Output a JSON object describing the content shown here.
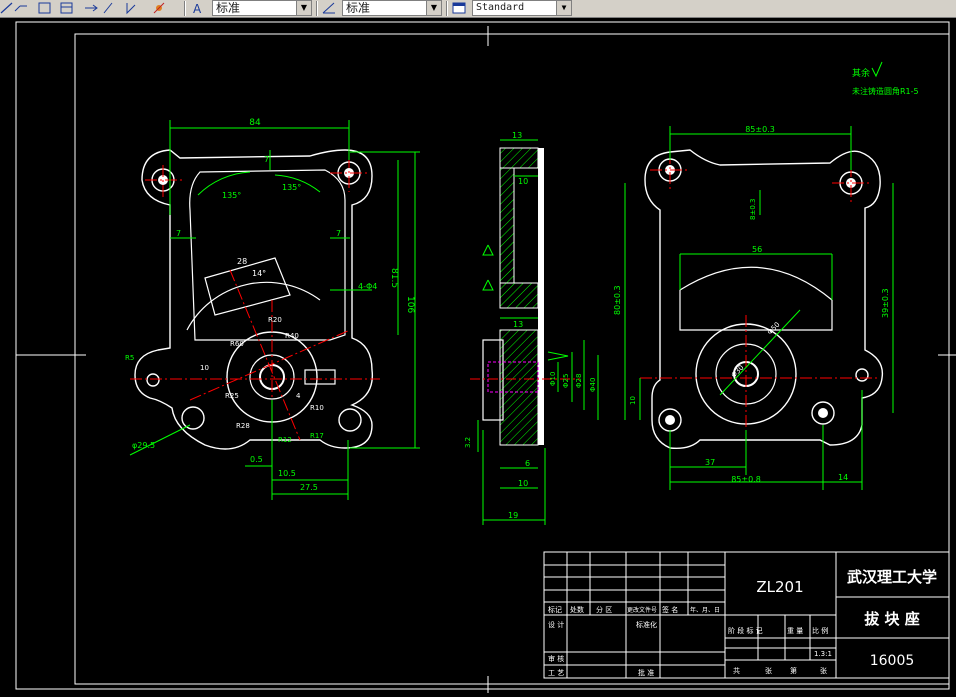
{
  "toolbar": {
    "text_style_value": "标准",
    "dim_style_value": "标准",
    "table_style_value": "Standard"
  },
  "drawing": {
    "roughness_symbol": "其余",
    "tech_note": "未注铸造圆角R1-5",
    "front_view_dims": {
      "width_top": "84",
      "angle_left": "135°",
      "angle_right": "135°",
      "d7_top": "7",
      "d7_left": "7",
      "d7_right": "7",
      "height_81_5": "81.5",
      "height_106": "106",
      "holes": "4-Φ4",
      "d28": "28",
      "angle_14": "14°",
      "r_lab_1": "R20",
      "r_lab_2": "R60",
      "r_lab_3": "R40",
      "r_lab_4": "R25",
      "r_lab_5": "R28",
      "d_0_5": "0.5",
      "d_10_5": "10.5",
      "d_27_5": "27.5",
      "d_r12": "R12",
      "d_phi_29_5": "φ29.5",
      "d_r5": "R5",
      "d_10_left": "10",
      "d_4": "4",
      "d_r10": "R10",
      "d_r17": "R17"
    },
    "section_view_dims": {
      "d13_top": "13",
      "d10_top": "10",
      "d13_mid": "13",
      "d_phi10": "Φ10",
      "d_phi25": "Φ25",
      "d_phi28": "Φ28",
      "d_phi40": "Φ40",
      "d6": "6",
      "d10_bot": "10",
      "d19": "19",
      "d3_2": "3.2"
    },
    "rear_view_dims": {
      "d85_top": "85±0.3",
      "d8_3": "8±0.3",
      "d56": "56",
      "d80_3": "80±0.3",
      "d39_3": "39±0.3",
      "d_phi50": "Φ50",
      "d_phi30": "Φ30",
      "d10": "10",
      "d37": "37",
      "d85_bot": "85±0.8",
      "d14": "14"
    }
  },
  "title_block": {
    "part_code": "ZL201",
    "school": "武汉理工大学",
    "part_name": "拔 块 座",
    "drawing_no": "16005",
    "col_headers": [
      "标记",
      "处数",
      "分 区",
      "更改文件号",
      "签 名",
      "年、月、日"
    ],
    "row_design": "设 计",
    "row_standard": "标准化",
    "row_review": "审 核",
    "row_process": "工 艺",
    "row_approve": "批 准",
    "stage_headers": [
      "阶 段 标 记",
      "重 量",
      "比 例"
    ],
    "scale": "1.3:1",
    "sheet_text": [
      "共",
      "张",
      "第",
      "张"
    ]
  },
  "colors": {
    "background": "#000000",
    "lines": "#ffffff",
    "dimensions": "#00ff00",
    "centerlines": "#ff0000",
    "hidden": "#ff00ff"
  }
}
